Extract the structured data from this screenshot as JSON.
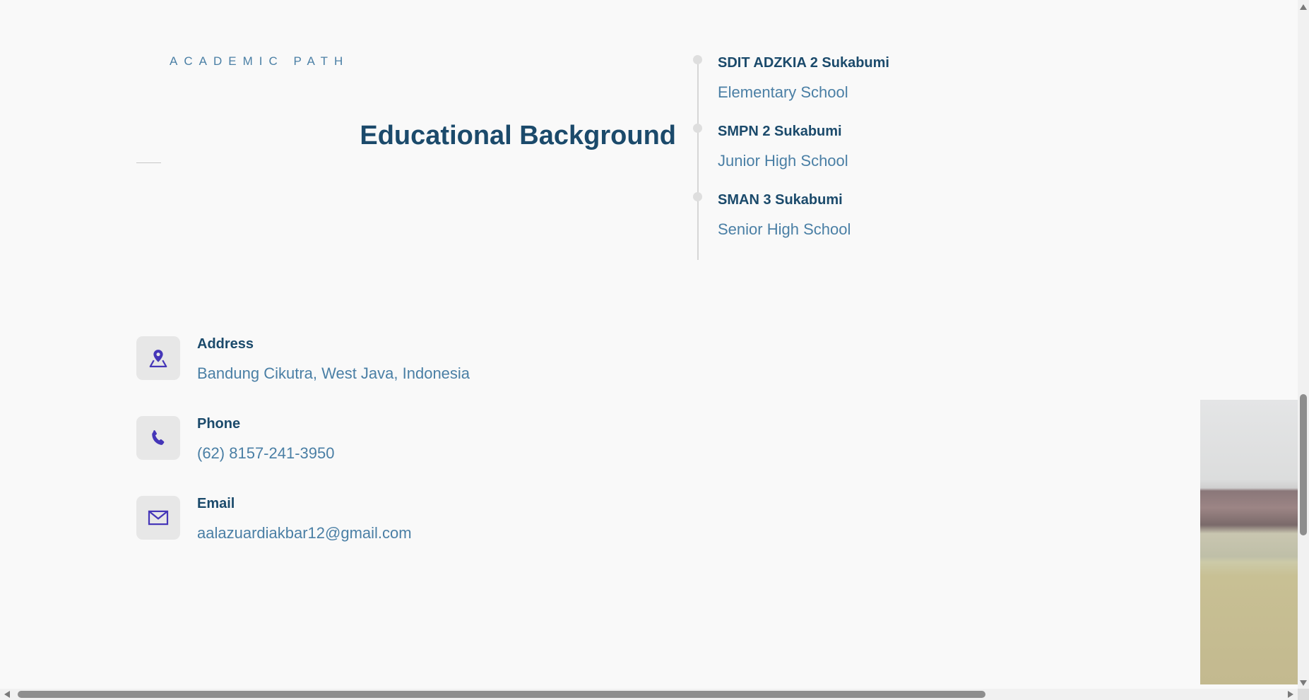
{
  "education": {
    "eyebrow": "ACADEMIC PATH",
    "title": "Educational Background",
    "timeline": [
      {
        "school": "SDIT ADZKIA 2 Sukabumi",
        "level": "Elementary School"
      },
      {
        "school": "SMPN 2 Sukabumi",
        "level": "Junior High School"
      },
      {
        "school": "SMAN 3 Sukabumi",
        "level": "Senior High School"
      }
    ]
  },
  "contact": {
    "items": [
      {
        "icon": "map-pin-icon",
        "label": "Address",
        "value": "Bandung Cikutra, West Java, Indonesia"
      },
      {
        "icon": "phone-icon",
        "label": "Phone",
        "value": "(62) 8157-241-3950"
      },
      {
        "icon": "mail-icon",
        "label": "Email",
        "value": "aalazuardiakbar12@gmail.com"
      }
    ]
  },
  "colors": {
    "heading": "#1b4a6b",
    "accent_text": "#4a7fa5",
    "icon": "#4536b8",
    "background": "#f9f9f9"
  }
}
